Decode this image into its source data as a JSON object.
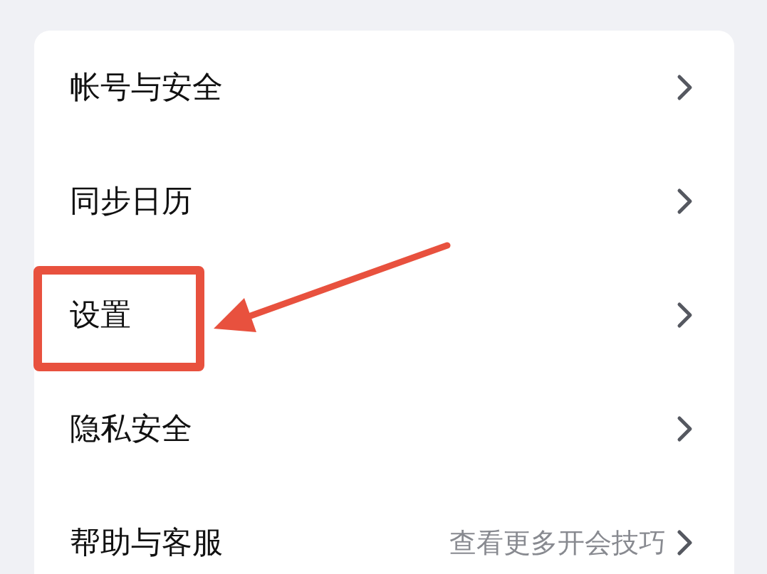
{
  "menu": [
    {
      "label": "帐号与安全",
      "highlighted": false
    },
    {
      "label": "同步日历",
      "highlighted": false
    },
    {
      "label": "设置",
      "highlighted": true
    },
    {
      "label": "隐私安全",
      "highlighted": false
    },
    {
      "label": "帮助与客服",
      "value": "查看更多开会技巧",
      "highlighted": false
    }
  ]
}
